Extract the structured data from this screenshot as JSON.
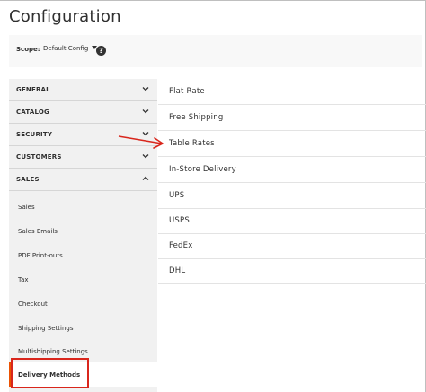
{
  "page": {
    "title": "Configuration"
  },
  "scope": {
    "label": "Scope:",
    "value": "Default Config",
    "help_icon": "question-circle"
  },
  "sidebar": {
    "sections": [
      {
        "label": "GENERAL",
        "state": "collapsed"
      },
      {
        "label": "CATALOG",
        "state": "collapsed"
      },
      {
        "label": "SECURITY",
        "state": "collapsed"
      },
      {
        "label": "CUSTOMERS",
        "state": "collapsed"
      },
      {
        "label": "SALES",
        "state": "expanded"
      }
    ],
    "sales_items": [
      {
        "label": "Sales"
      },
      {
        "label": "Sales Emails"
      },
      {
        "label": "PDF Print-outs"
      },
      {
        "label": "Tax"
      },
      {
        "label": "Checkout"
      },
      {
        "label": "Shipping Settings"
      },
      {
        "label": "Multishipping Settings"
      },
      {
        "label": "Delivery Methods",
        "active": true
      }
    ]
  },
  "methods": [
    {
      "label": "Flat Rate"
    },
    {
      "label": "Free Shipping"
    },
    {
      "label": "Table Rates"
    },
    {
      "label": "In-Store Delivery"
    },
    {
      "label": "UPS"
    },
    {
      "label": "USPS"
    },
    {
      "label": "FedEx"
    },
    {
      "label": "DHL"
    }
  ],
  "annotation": {
    "arrow_color": "#d9261c",
    "box_color": "#d9261c",
    "accent_color": "#eb5202"
  }
}
